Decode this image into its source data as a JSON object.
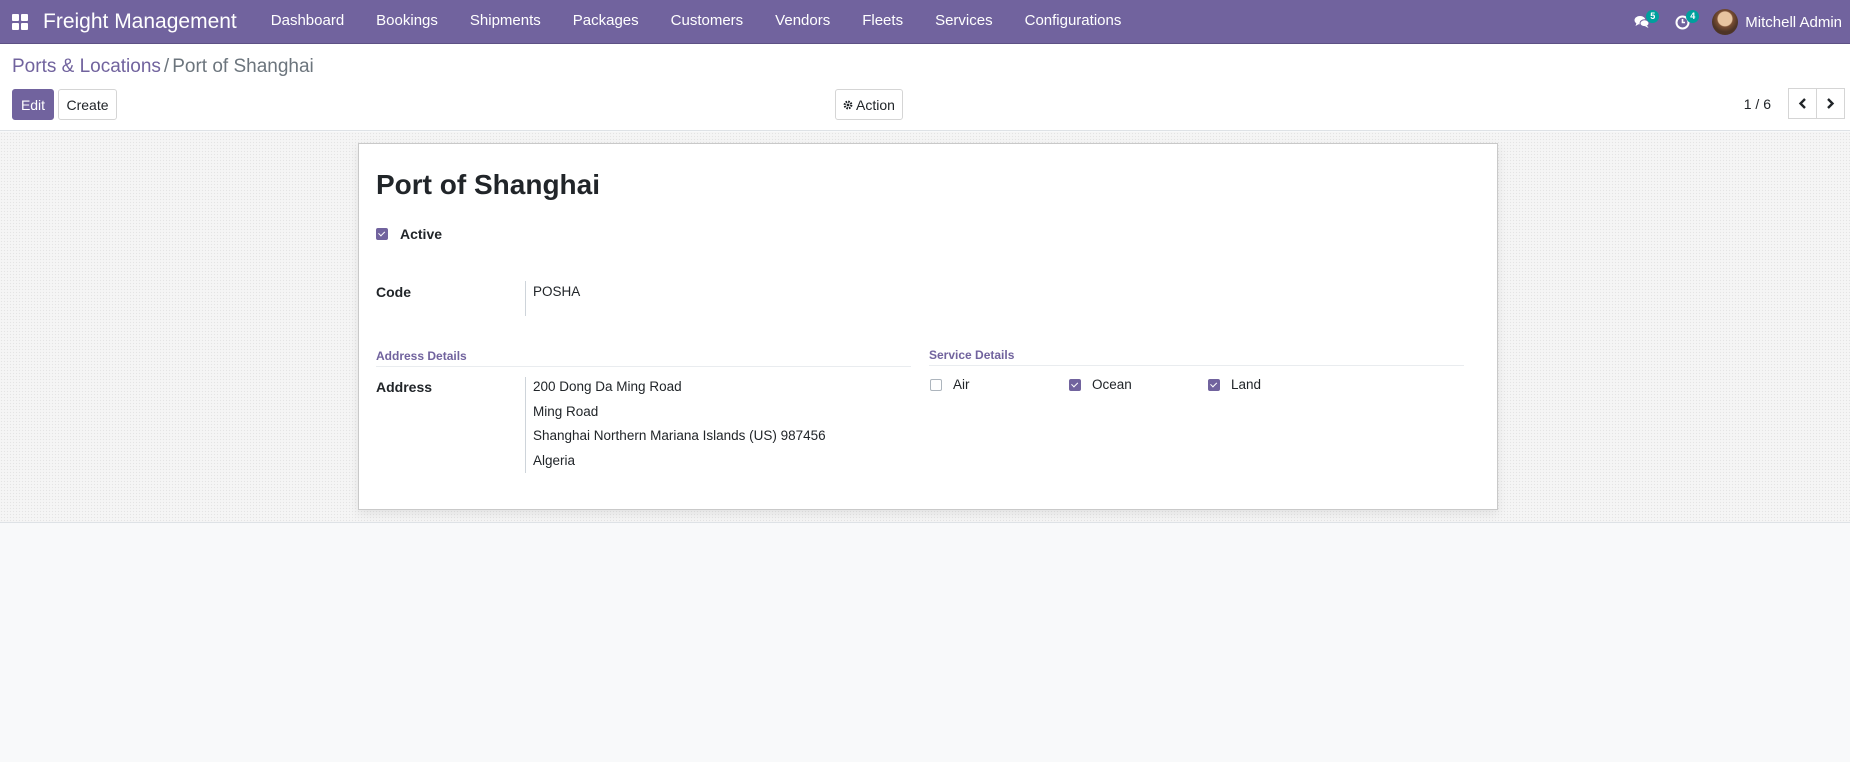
{
  "navbar": {
    "app_name": "Freight Management",
    "menu": [
      "Dashboard",
      "Bookings",
      "Shipments",
      "Packages",
      "Customers",
      "Vendors",
      "Fleets",
      "Services",
      "Configurations"
    ],
    "messages_count": "5",
    "activities_count": "4",
    "user_name": "Mitchell Admin"
  },
  "breadcrumb": {
    "parent": "Ports & Locations",
    "separator": "/",
    "current": "Port of Shanghai"
  },
  "toolbar": {
    "edit_label": "Edit",
    "create_label": "Create",
    "action_label": "Action"
  },
  "pager": {
    "value": "1 / 6"
  },
  "record": {
    "name": "Port of Shanghai",
    "active_label": "Active",
    "active": true,
    "code_label": "Code",
    "code": "POSHA",
    "address_group_title": "Address Details",
    "address_label": "Address",
    "address_lines": [
      "200 Dong Da Ming Road",
      "Ming Road",
      "Shanghai  Northern Mariana Islands (US)  987456",
      "Algeria"
    ],
    "service_group_title": "Service Details",
    "services": [
      {
        "label": "Air",
        "checked": false
      },
      {
        "label": "Ocean",
        "checked": true
      },
      {
        "label": "Land",
        "checked": true
      }
    ]
  },
  "colors": {
    "brand": "#71639e",
    "badge": "#00a09d"
  }
}
